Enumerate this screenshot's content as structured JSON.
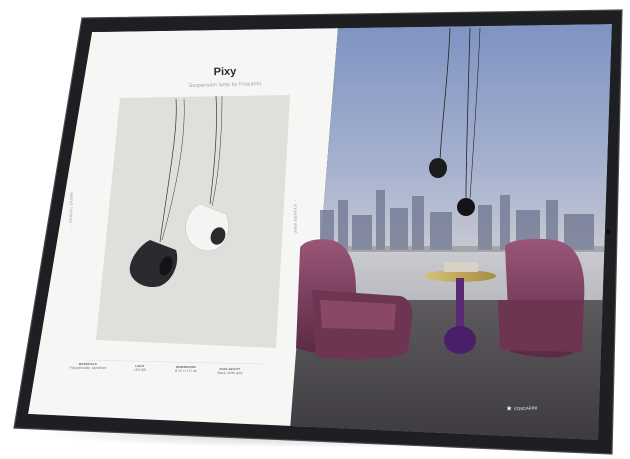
{
  "product": {
    "title": "Pixy",
    "subtitle": "Suspension lamp by Foscarini"
  },
  "side_labels": {
    "left": "← SCROLL DOWN",
    "right": "VIEW DETAILS →"
  },
  "specs": [
    {
      "label": "MATERIALS",
      "value": "Polycarbonate, aluminium"
    },
    {
      "label": "LIGHT",
      "value": "LED 8W"
    },
    {
      "label": "DIMENSIONS",
      "value": "Ø 13 × H 17 cm"
    },
    {
      "label": "AVAILABILITY",
      "value": "Black, white, grey"
    }
  ],
  "brand": {
    "icon": "star-icon",
    "label": "FOSCARINI"
  },
  "colors": {
    "bezel": "#1e1f22",
    "panel_bg": "#f6f6f4",
    "photo_bg": "#dfdfdc",
    "sky_top": "#8ea0c6",
    "sky_bottom": "#c7c9cf",
    "armchair": "#7a3d5c"
  }
}
